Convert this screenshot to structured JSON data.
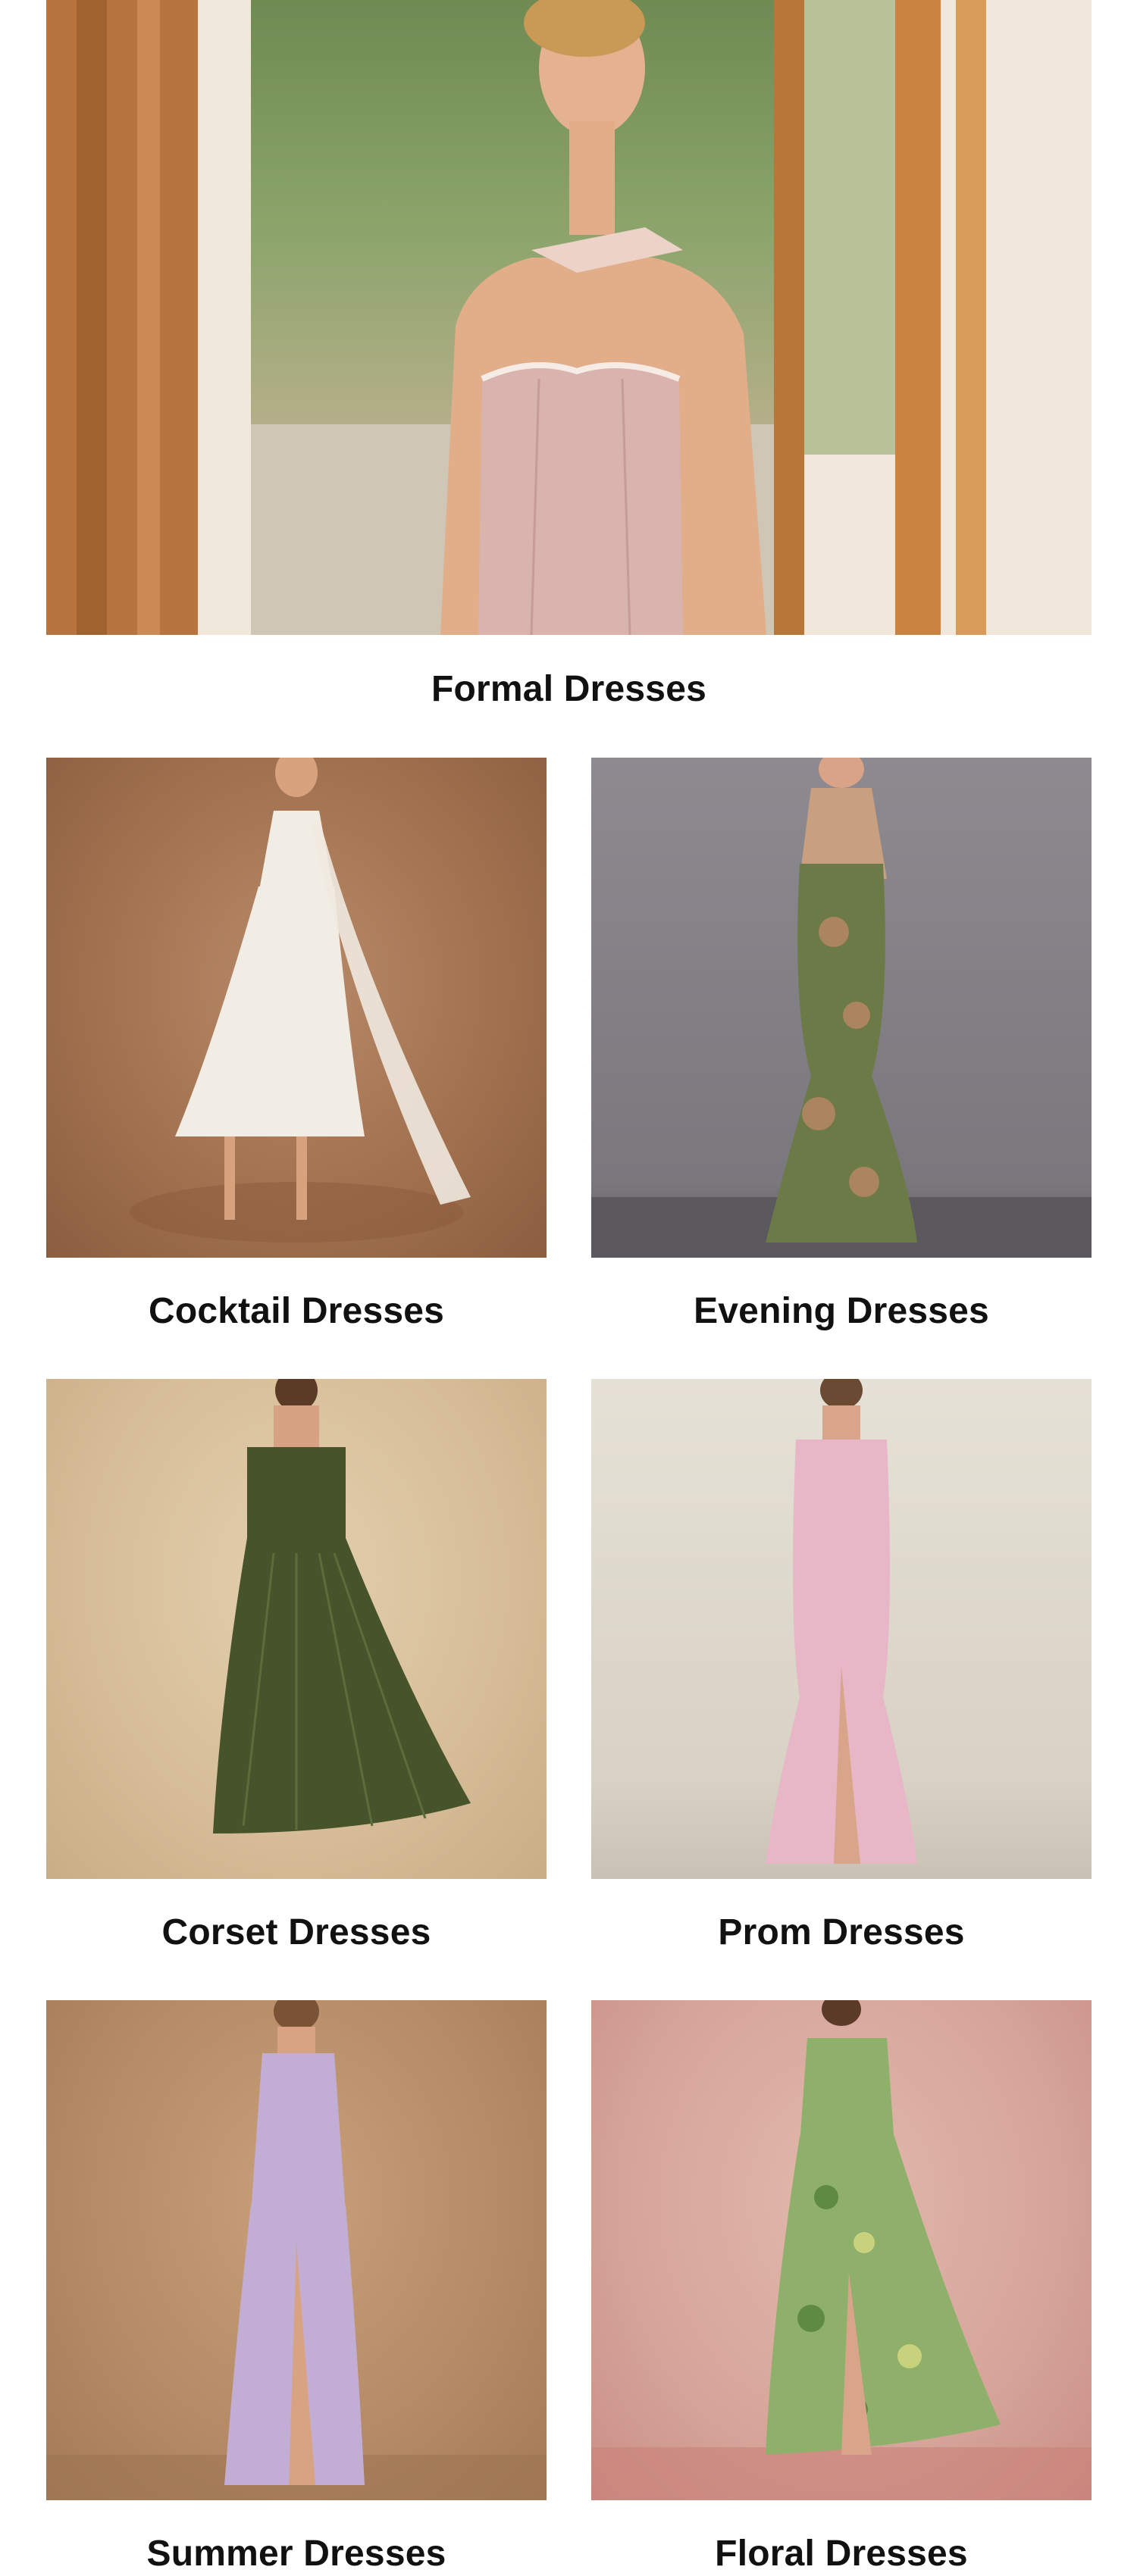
{
  "categories": [
    {
      "label": "Formal Dresses",
      "image_icon": "formal-dress-photo"
    },
    {
      "label": "Cocktail Dresses",
      "image_icon": "cocktail-dress-photo"
    },
    {
      "label": "Evening Dresses",
      "image_icon": "evening-dress-photo"
    },
    {
      "label": "Corset Dresses",
      "image_icon": "corset-dress-photo"
    },
    {
      "label": "Prom Dresses",
      "image_icon": "prom-dress-photo"
    },
    {
      "label": "Summer Dresses",
      "image_icon": "summer-dress-photo"
    },
    {
      "label": "Floral Dresses",
      "image_icon": "floral-dress-photo"
    }
  ],
  "colors": {
    "background": "#ffffff",
    "label_text": "#111111",
    "formal_dress": "#d9b3ad",
    "cocktail_dress": "#f1ede4",
    "evening_dress": "#6c7a47",
    "corset_dress": "#46532b",
    "prom_dress": "#e7b6c7",
    "summer_dress": "#c2aed4",
    "floral_dress": "#8fb06a"
  }
}
